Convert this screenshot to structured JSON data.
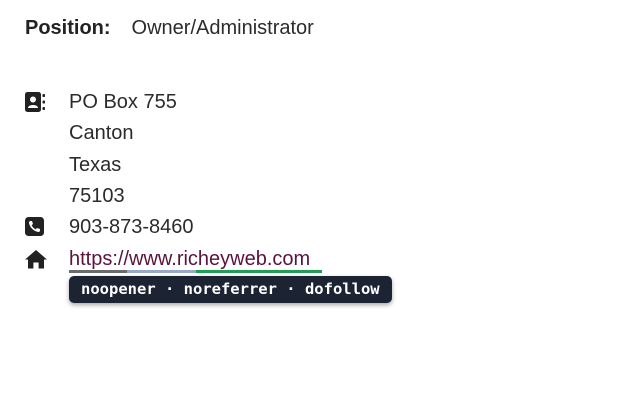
{
  "position": {
    "label": "Position:",
    "value": "Owner/Administrator"
  },
  "address": {
    "icon": "address-book-icon",
    "lines": [
      "PO Box 755",
      "Canton",
      "Texas",
      "75103"
    ]
  },
  "phone": {
    "icon": "phone-icon",
    "number": "903-873-8460"
  },
  "website": {
    "icon": "home-icon",
    "url": "https://www.richeyweb.com",
    "link_color": "#5a1240"
  },
  "link_tooltip": {
    "text": "noopener · noreferrer · dofollow",
    "background": "#1c2333",
    "status_colors": {
      "noopener": "#6b6b6b",
      "noreferrer": "#9aa8c8",
      "dofollow": "#1f9d55"
    }
  }
}
